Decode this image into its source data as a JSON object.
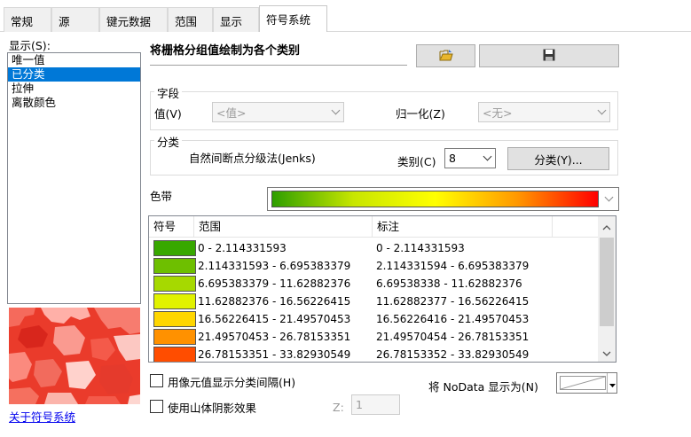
{
  "tabs": [
    {
      "label": "常规"
    },
    {
      "label": "源"
    },
    {
      "label": "键元数据"
    },
    {
      "label": "范围"
    },
    {
      "label": "显示"
    },
    {
      "label": "符号系统"
    }
  ],
  "show_label": "显示(S):",
  "renderer_list": [
    "唯一值",
    "已分类",
    "拉伸",
    "离散颜色"
  ],
  "about_link": "关于符号系统",
  "heading": "将栅格分组值绘制为各个类别",
  "field_group": {
    "title": "字段",
    "value_label": "值(V)",
    "value_selected": "<值>",
    "normalize_label": "归一化(Z)",
    "normalize_selected": "<无>"
  },
  "classification": {
    "title": "分类",
    "method": "自然间断点分级法(Jenks)",
    "classes_label": "类别(C)",
    "classes_value": "8",
    "classify_button": "分类(Y)..."
  },
  "color_ramp": {
    "label": "色带",
    "colors": [
      "#2e9e00",
      "#c8e600",
      "#ffff00",
      "#ff9900",
      "#ff0000"
    ]
  },
  "table": {
    "headers": [
      "符号",
      "范围",
      "标注"
    ],
    "rows": [
      {
        "color": "#38a800",
        "range": "0 - 2.114331593",
        "label": "0 - 2.114331593"
      },
      {
        "color": "#6ebf00",
        "range": "2.114331593 - 6.695383379",
        "label": "2.114331594 - 6.695383379"
      },
      {
        "color": "#a6d900",
        "range": "6.695383379 - 11.62882376",
        "label": "6.69538338 - 11.62882376"
      },
      {
        "color": "#e1f200",
        "range": "11.62882376 - 16.56226415",
        "label": "11.62882377 - 16.56226415"
      },
      {
        "color": "#ffd600",
        "range": "16.56226415 - 21.49570453",
        "label": "16.56226416 - 21.49570453"
      },
      {
        "color": "#ff9100",
        "range": "21.49570453 - 26.78153351",
        "label": "21.49570454 - 26.78153351"
      },
      {
        "color": "#ff4d00",
        "range": "26.78153351 - 33.82930549",
        "label": "26.78153352 - 33.82930549"
      }
    ]
  },
  "options": {
    "show_class_breaks": "用像元值显示分类间隔(H)",
    "use_hillshade": "使用山体阴影效果",
    "z_label": "Z:",
    "z_value": "1",
    "nodata_label": "将 NoData 显示为(N)"
  }
}
